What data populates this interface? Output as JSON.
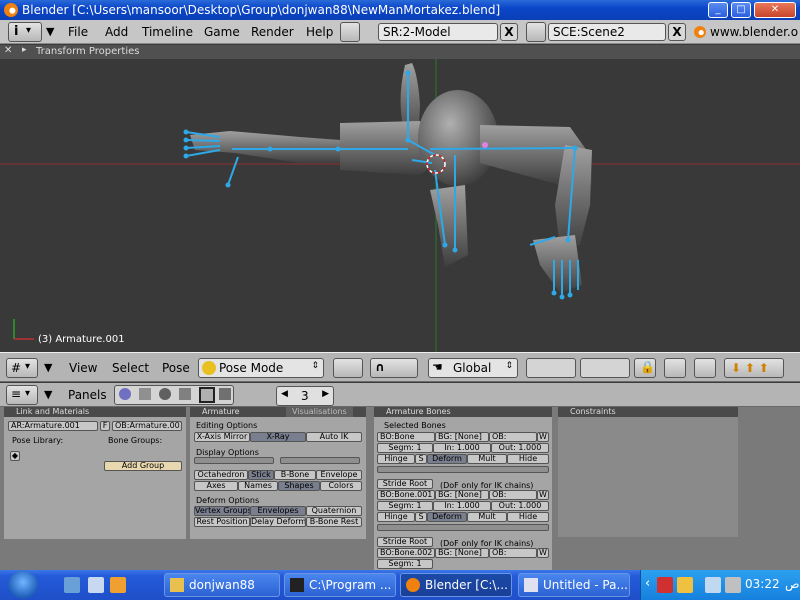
{
  "window": {
    "title": "Blender [C:\\Users\\mansoor\\Desktop\\Group\\donjwan88\\NewManMortakez.blend]"
  },
  "menu": {
    "items": [
      "File",
      "Add",
      "Timeline",
      "Game",
      "Render",
      "Help"
    ],
    "screen": "SR:2-Model",
    "scene": "SCE:Scene2",
    "url": "www.blender.o"
  },
  "viewport": {
    "header_label": "Transform Properties",
    "object_info": "(3) Armature.001"
  },
  "view3d_header": {
    "view": "View",
    "select": "Select",
    "pose": "Pose",
    "mode": "Pose Mode",
    "orientation": "Global"
  },
  "buttons_header": {
    "panels": "Panels",
    "frame": "3"
  },
  "panels": {
    "link": {
      "title": "Link and Materials",
      "ar_field": "AR:Armature.001",
      "f_button": "F",
      "ob_field": "OB:Armature.001",
      "pose_library": "Pose Library:",
      "bone_groups": "Bone Groups:",
      "add_group": "Add Group"
    },
    "armature": {
      "tab_active": "Armature",
      "tab_inactive": "Visualisations",
      "editing_options": "Editing Options",
      "x_axis_mirror": "X-Axis Mirror",
      "x_ray": "X-Ray",
      "auto_ik": "Auto IK",
      "display_options": "Display Options",
      "octahedron": "Octahedron",
      "stick": "Stick",
      "bbone": "B-Bone",
      "envelope": "Envelope",
      "axes": "Axes",
      "names": "Names",
      "shapes": "Shapes",
      "colors": "Colors",
      "deform_options": "Deform Options",
      "vertex_groups": "Vertex Groups",
      "envelopes": "Envelopes",
      "quaternion": "Quaternion",
      "rest_position": "Rest Position",
      "delay_deform": "Delay Deform",
      "bbone_rest": "B-Bone Rest"
    },
    "bones": {
      "title": "Armature Bones",
      "selected": "Selected Bones",
      "entries": [
        {
          "bo": "BO:Bone",
          "bg": "BG: [None]",
          "ob": "OB:",
          "w": "W",
          "segm": "Segm: 1",
          "in": "In: 1.000",
          "out": "Out: 1.000",
          "hinge": "Hinge",
          "s": "S",
          "deform": "Deform",
          "mult": "Mult",
          "hide": "Hide",
          "stride": "Stride Root",
          "ik_note": "(DoF only for IK chains)"
        },
        {
          "bo": "BO:Bone.001",
          "bg": "BG: [None]",
          "ob": "OB:",
          "w": "W",
          "segm": "Segm: 1",
          "in": "In: 1.000",
          "out": "Out: 1.000",
          "hinge": "Hinge",
          "s": "S",
          "deform": "Deform",
          "mult": "Mult",
          "hide": "Hide",
          "stride": "Stride Root",
          "ik_note": "(DoF only for IK chains)"
        },
        {
          "bo": "BO:Bone.002",
          "bg": "BG: [None]",
          "ob": "OB:",
          "w": "W",
          "segm": "Segm: 1"
        }
      ]
    },
    "constraints": {
      "title": "Constraints"
    }
  },
  "taskbar": {
    "tasks": [
      {
        "label": "donjwan88"
      },
      {
        "label": "C:\\Program ..."
      },
      {
        "label": "Blender [C:\\..."
      },
      {
        "label": "Untitled - Pa..."
      }
    ],
    "clock": "03:22",
    "locale": "ص"
  },
  "colors": {
    "bone": "#2fa8e8",
    "title_blue": "#0b46c9",
    "panel_bg": "#a5a5a5"
  }
}
